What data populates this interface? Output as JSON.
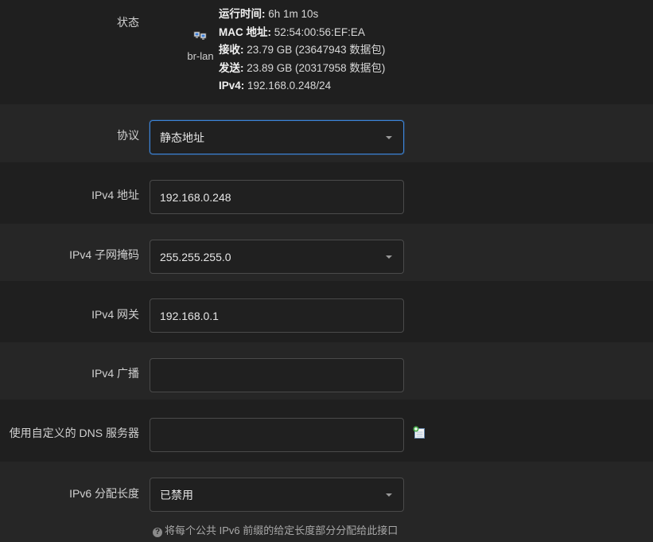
{
  "status": {
    "label": "状态",
    "interface": {
      "name": "br-lan",
      "icon": "network-interface-icon"
    },
    "lines": [
      {
        "key": "运行时间:",
        "value": " 6h 1m 10s"
      },
      {
        "key": "MAC 地址:",
        "value": " 52:54:00:56:EF:EA"
      },
      {
        "key": "接收:",
        "value": " 23.79 GB (23647943 数据包)"
      },
      {
        "key": "发送:",
        "value": " 23.89 GB (20317958 数据包)"
      },
      {
        "key": "IPv4:",
        "value": " 192.168.0.248/24"
      }
    ]
  },
  "fields": {
    "protocol": {
      "label": "协议",
      "value": "静态地址"
    },
    "ipv4_address": {
      "label": "IPv4 地址",
      "value": "192.168.0.248"
    },
    "ipv4_netmask": {
      "label": "IPv4 子网掩码",
      "value": "255.255.255.0"
    },
    "ipv4_gateway": {
      "label": "IPv4 网关",
      "value": "192.168.0.1"
    },
    "ipv4_broadcast": {
      "label": "IPv4 广播",
      "value": ""
    },
    "custom_dns": {
      "label": "使用自定义的 DNS 服务器",
      "value": "",
      "add_icon": "add-entry-icon"
    },
    "ipv6_assign": {
      "label": "IPv6 分配长度",
      "value": "已禁用",
      "hint": "将每个公共 IPv6 前缀的给定长度部分分配给此接口",
      "hint_icon": "help-icon"
    }
  },
  "colors": {
    "background": "#1f1f1f",
    "row_alt": "#262626",
    "input_border": "#4a4a4a",
    "focus_border": "#3c84d8"
  }
}
